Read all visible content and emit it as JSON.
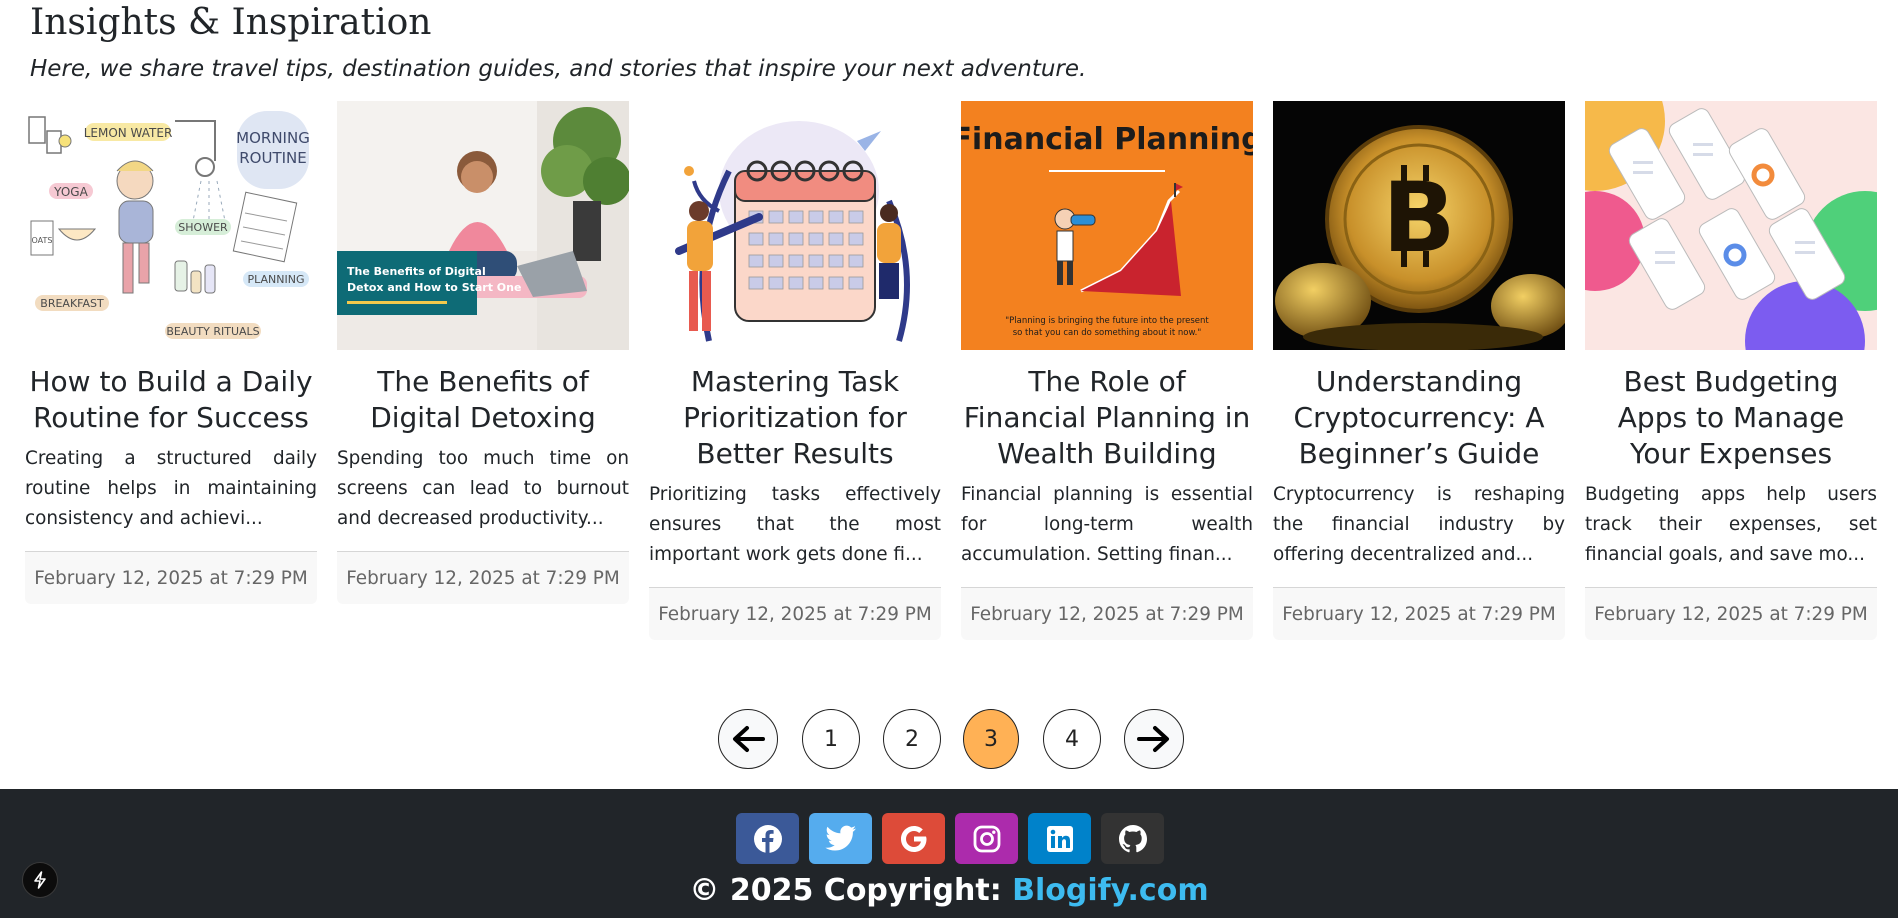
{
  "header": {
    "title": "Insights & Inspiration",
    "subtitle": "Here, we share travel tips, destination guides, and stories that inspire your next adventure."
  },
  "posts": [
    {
      "title": "How to Build a Daily Routine for Success",
      "excerpt": "Creating a structured daily routine helps in maintaining consistency and achievi...",
      "date": "February 12, 2025 at 7:29 PM",
      "image_labels": [
        "LEMON WATER",
        "MORNING",
        "ROUTINE",
        "YOGA",
        "SHOWER",
        "OATS",
        "BREAKFAST",
        "PLANNING",
        "BEAUTY RITUALS"
      ]
    },
    {
      "title": "The Benefits of Digital Detoxing",
      "excerpt": "Spending too much time on screens can lead to burnout and decreased productivity...",
      "date": "February 12, 2025 at 7:29 PM",
      "image_label_1": "The Benefits of Digital",
      "image_label_2": "Detox and How to Start One"
    },
    {
      "title": "Mastering Task Prioritization for Better Results",
      "excerpt": "Prioritizing tasks effectively ensures that the most important work gets done fi...",
      "date": "February 12, 2025 at 7:29 PM"
    },
    {
      "title": "The Role of Financial Planning in Wealth Building",
      "excerpt": "Financial planning is essential for long-term wealth accumulation. Setting finan...",
      "date": "February 12, 2025 at 7:29 PM",
      "image_heading": "Financial Planning",
      "image_quote_1": "\"Planning is bringing the future into the present",
      "image_quote_2": "so that you can do something about it now.\""
    },
    {
      "title": "Understanding Cryptocurrency: A Beginner’s Guide",
      "excerpt": "Cryptocurrency is reshaping the financial industry by offering decentralized and...",
      "date": "February 12, 2025 at 7:29 PM"
    },
    {
      "title": "Best Budgeting Apps to Manage Your Expenses",
      "excerpt": "Budgeting apps help users track their expenses, set financial goals, and save mo...",
      "date": "February 12, 2025 at 7:29 PM"
    }
  ],
  "pagination": {
    "prev_icon": "arrow-left-icon",
    "next_icon": "arrow-right-icon",
    "pages": [
      "1",
      "2",
      "3",
      "4"
    ],
    "current": "3",
    "active_color": "#ffb155"
  },
  "footer": {
    "copyright_prefix": "© 2025 Copyright: ",
    "brand": "Blogify.com",
    "background": "#212529",
    "brand_color": "#3dbbf0",
    "social": [
      {
        "name": "facebook-icon",
        "color": "#3b5998"
      },
      {
        "name": "twitter-icon",
        "color": "#55acee"
      },
      {
        "name": "google-icon",
        "color": "#dd4b39"
      },
      {
        "name": "instagram-icon",
        "color": "#ac2bac"
      },
      {
        "name": "linkedin-icon",
        "color": "#0082ca"
      },
      {
        "name": "github-icon",
        "color": "#333333"
      }
    ]
  },
  "dev_tools_icon": "lightning-bolt-icon"
}
